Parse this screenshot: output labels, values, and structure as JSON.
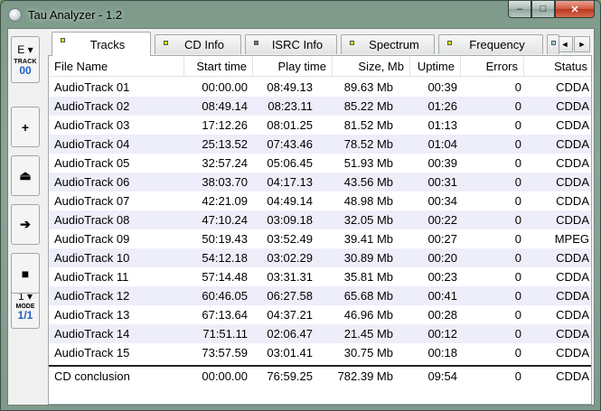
{
  "window": {
    "title": "Tau Analyzer - 1.2",
    "min": "–",
    "max": "□",
    "close": "✕"
  },
  "toolbar": {
    "drive": {
      "value": "E",
      "caption": "TRACK",
      "number": "00"
    },
    "buttons": [
      {
        "name": "add-button",
        "glyph": "+"
      },
      {
        "name": "eject-button",
        "glyph": "⏏"
      },
      {
        "name": "next-button",
        "glyph": "➔"
      },
      {
        "name": "stop-button",
        "glyph": "■"
      }
    ],
    "mode": {
      "value": "1",
      "caption": "MODE",
      "number": "1/1"
    }
  },
  "tabs": [
    {
      "label": "Tracks",
      "led": "#d8e400"
    },
    {
      "label": "CD Info",
      "led": "#d8e400"
    },
    {
      "label": "ISRC Info",
      "led": "#707070"
    },
    {
      "label": "Spectrum",
      "led": "#d8e400"
    },
    {
      "label": "Frequency",
      "led": "#d8e400"
    }
  ],
  "tab_scroll": {
    "left": "◄",
    "right": "►"
  },
  "columns": [
    "File Name",
    "Start time",
    "Play time",
    "Size, Mb",
    "Uptime",
    "Errors",
    "Status"
  ],
  "rows": [
    [
      "AudioTrack 01",
      "00:00.00",
      "08:49.13",
      "89.63 Mb",
      "00:39",
      "0",
      "CDDA"
    ],
    [
      "AudioTrack 02",
      "08:49.14",
      "08:23.11",
      "85.22 Mb",
      "01:26",
      "0",
      "CDDA"
    ],
    [
      "AudioTrack 03",
      "17:12.26",
      "08:01.25",
      "81.52 Mb",
      "01:13",
      "0",
      "CDDA"
    ],
    [
      "AudioTrack 04",
      "25:13.52",
      "07:43.46",
      "78.52 Mb",
      "01:04",
      "0",
      "CDDA"
    ],
    [
      "AudioTrack 05",
      "32:57.24",
      "05:06.45",
      "51.93 Mb",
      "00:39",
      "0",
      "CDDA"
    ],
    [
      "AudioTrack 06",
      "38:03.70",
      "04:17.13",
      "43.56 Mb",
      "00:31",
      "0",
      "CDDA"
    ],
    [
      "AudioTrack 07",
      "42:21.09",
      "04:49.14",
      "48.98 Mb",
      "00:34",
      "0",
      "CDDA"
    ],
    [
      "AudioTrack 08",
      "47:10.24",
      "03:09.18",
      "32.05 Mb",
      "00:22",
      "0",
      "CDDA"
    ],
    [
      "AudioTrack 09",
      "50:19.43",
      "03:52.49",
      "39.41 Mb",
      "00:27",
      "0",
      "MPEG"
    ],
    [
      "AudioTrack 10",
      "54:12.18",
      "03:02.29",
      "30.89 Mb",
      "00:20",
      "0",
      "CDDA"
    ],
    [
      "AudioTrack 11",
      "57:14.48",
      "03:31.31",
      "35.81 Mb",
      "00:23",
      "0",
      "CDDA"
    ],
    [
      "AudioTrack 12",
      "60:46.05",
      "06:27.58",
      "65.68 Mb",
      "00:41",
      "0",
      "CDDA"
    ],
    [
      "AudioTrack 13",
      "67:13.64",
      "04:37.21",
      "46.96 Mb",
      "00:28",
      "0",
      "CDDA"
    ],
    [
      "AudioTrack 14",
      "71:51.11",
      "02:06.47",
      "21.45 Mb",
      "00:12",
      "0",
      "CDDA"
    ],
    [
      "AudioTrack 15",
      "73:57.59",
      "03:01.41",
      "30.75 Mb",
      "00:18",
      "0",
      "CDDA"
    ]
  ],
  "summary": [
    "CD conclusion",
    "00:00.00",
    "76:59.25",
    "782.39 Mb",
    "09:54",
    "0",
    "CDDA"
  ]
}
